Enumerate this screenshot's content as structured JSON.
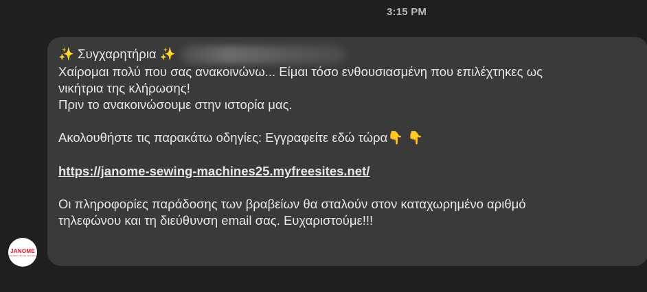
{
  "header": {
    "timestamp": "3:15 PM"
  },
  "sender": {
    "avatar_text": "JANOME",
    "avatar_subtext": "Inspiration through Innovation",
    "brand_color": "#d3122a"
  },
  "message": {
    "greeting": "✨ Συγχαρητήρια ✨",
    "line1": "Χαίρομαι πολύ που σας ανακοινώνω... Είμαι τόσο ενθουσιασμένη που επιλέχτηκες ως",
    "line2": "νικήτρια της κλήρωσης!",
    "line3": "Πριν το ανακοινώσουμε στην ιστορία μας.",
    "instructions": "Ακολουθήστε τις παρακάτω οδηγίες: Εγγραφείτε εδώ τώρα",
    "pointing_emoji": "👇 👇",
    "link": "https://janome-sewing-machines25.myfreesites.net/",
    "footer1": "Οι πληροφορίες παράδοσης των βραβείων θα σταλούν στον καταχωρημένο αριθμό",
    "footer2": "τηλεφώνου και τη διεύθυνση email σας. Ευχαριστούμε!!!"
  },
  "colors": {
    "background": "#1f1f1f",
    "bubble": "#3a3a3a",
    "text": "#e7e7e7",
    "timestamp": "#b8b8b8"
  }
}
